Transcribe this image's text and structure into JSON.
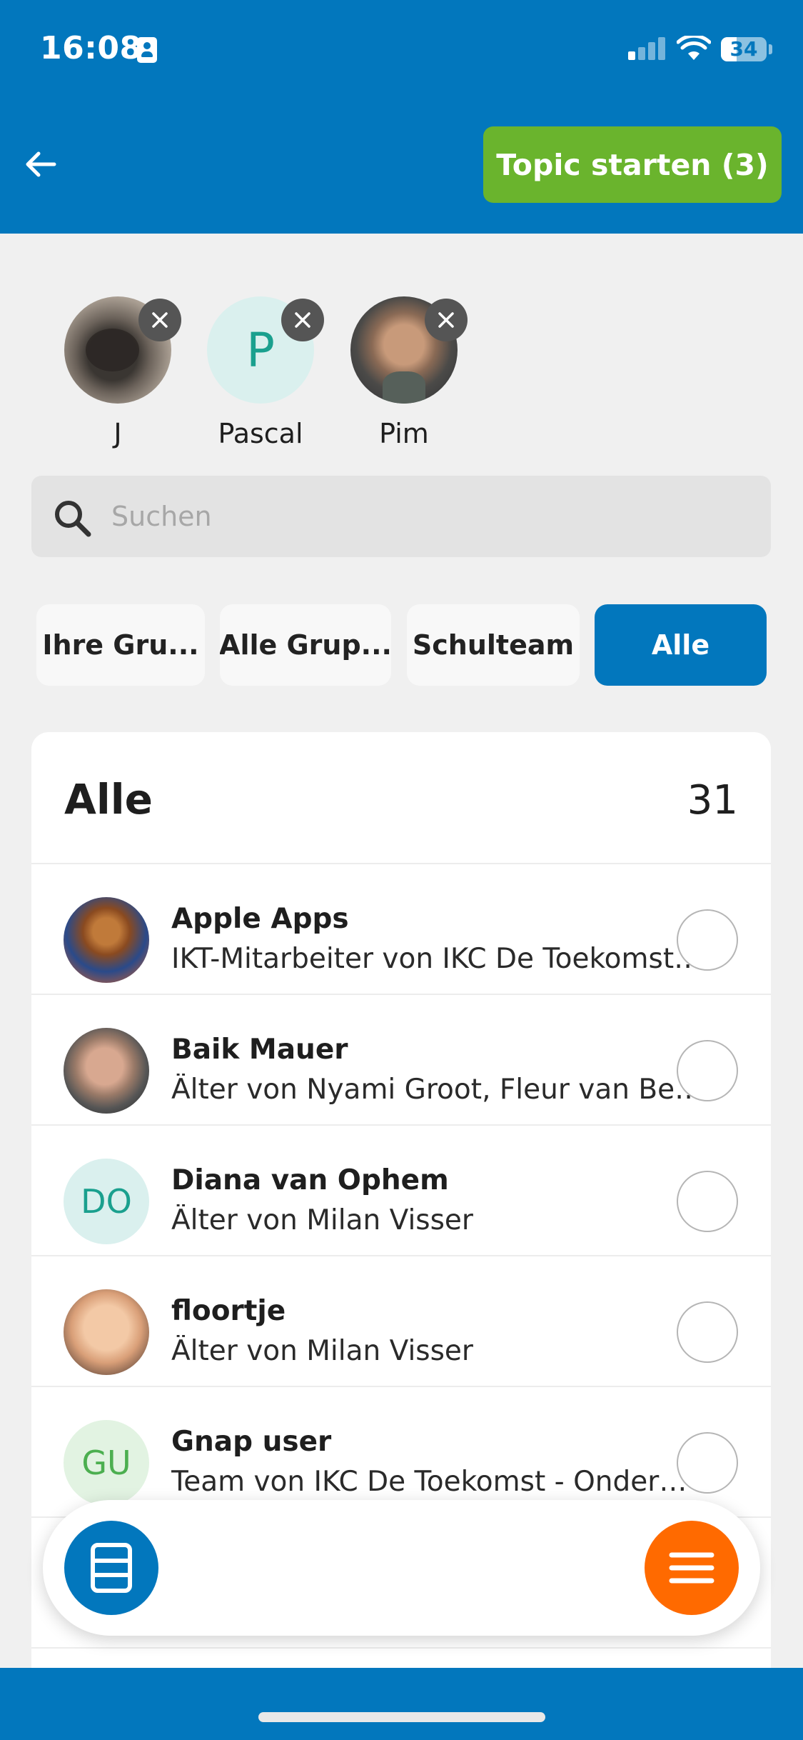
{
  "status_bar": {
    "time": "16:08",
    "battery": "34",
    "battery_level": 0.34,
    "signal_bars_active": 1
  },
  "header": {
    "topic_button_label": "Topic starten (3)"
  },
  "selected": [
    {
      "label": "J",
      "avatar": "photo"
    },
    {
      "label": "Pascal",
      "avatar_initial": "P"
    },
    {
      "label": "Pim",
      "avatar": "photo"
    }
  ],
  "search": {
    "placeholder": "Suchen",
    "value": ""
  },
  "filters": [
    {
      "label": "Ihre Gru...",
      "active": false
    },
    {
      "label": "Alle Grup...",
      "active": false
    },
    {
      "label": "Schulteam",
      "active": false
    },
    {
      "label": "Alle",
      "active": true
    }
  ],
  "list": {
    "title": "Alle",
    "count": "31",
    "rows": [
      {
        "name": "Apple Apps",
        "subtitle": "IKT-Mitarbeiter von IKC De Toekomst - Onderwijs",
        "avatar": "photo",
        "selected": false
      },
      {
        "name": "Baik Mauer",
        "subtitle": "Älter von Nyami Groot, Fleur van Beek",
        "avatar": "photo",
        "selected": false
      },
      {
        "name": "Diana van Ophem",
        "subtitle": "Älter von Milan Visser",
        "avatar_initials": "DO",
        "selected": false
      },
      {
        "name": "floortje",
        "subtitle": "Älter von Milan Visser",
        "avatar": "photo",
        "selected": false
      },
      {
        "name": "Gnap user",
        "subtitle": "Team von IKC De Toekomst - Onderwijs",
        "avatar_initials": "GU",
        "selected": false
      }
    ]
  },
  "colors": {
    "brand_blue": "#0277bd",
    "action_green": "#6ab42d",
    "menu_orange": "#ff6a00"
  },
  "icons": {
    "back": "arrow-left-icon",
    "remove": "close-icon",
    "search": "search-icon",
    "left_fab": "archive-icon",
    "right_fab": "menu-icon"
  }
}
